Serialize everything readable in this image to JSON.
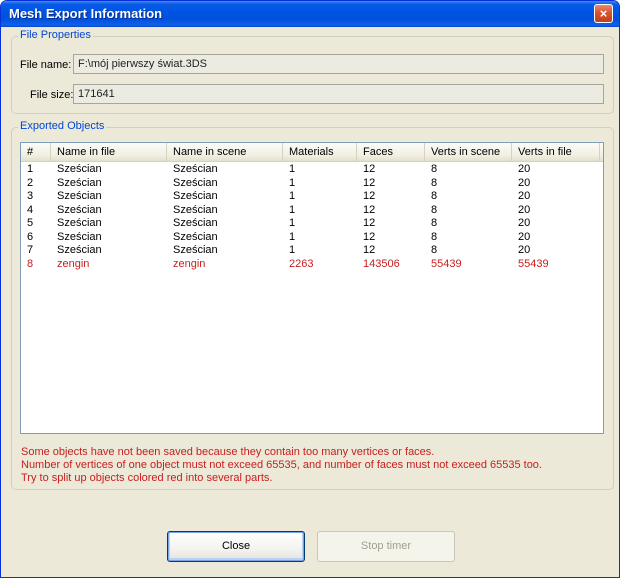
{
  "window": {
    "title": "Mesh Export Information",
    "close_glyph": "×"
  },
  "file_properties": {
    "group_title": "File Properties",
    "name_label": "File name:",
    "name_value": "F:\\mój pierwszy świat.3DS",
    "size_label": "File size:",
    "size_value": "171641"
  },
  "exported_objects": {
    "group_title": "Exported Objects",
    "columns": [
      "#",
      "Name in file",
      "Name in scene",
      "Materials",
      "Faces",
      "Verts in scene",
      "Verts in file"
    ],
    "rows": [
      {
        "num": "1",
        "name_file": "Sześcian",
        "name_scene": "Sześcian",
        "materials": "1",
        "faces": "12",
        "verts_scene": "8",
        "verts_file": "20",
        "error": false
      },
      {
        "num": "2",
        "name_file": "Sześcian",
        "name_scene": "Sześcian",
        "materials": "1",
        "faces": "12",
        "verts_scene": "8",
        "verts_file": "20",
        "error": false
      },
      {
        "num": "3",
        "name_file": "Sześcian",
        "name_scene": "Sześcian",
        "materials": "1",
        "faces": "12",
        "verts_scene": "8",
        "verts_file": "20",
        "error": false
      },
      {
        "num": "4",
        "name_file": "Sześcian",
        "name_scene": "Sześcian",
        "materials": "1",
        "faces": "12",
        "verts_scene": "8",
        "verts_file": "20",
        "error": false
      },
      {
        "num": "5",
        "name_file": "Sześcian",
        "name_scene": "Sześcian",
        "materials": "1",
        "faces": "12",
        "verts_scene": "8",
        "verts_file": "20",
        "error": false
      },
      {
        "num": "6",
        "name_file": "Sześcian",
        "name_scene": "Sześcian",
        "materials": "1",
        "faces": "12",
        "verts_scene": "8",
        "verts_file": "20",
        "error": false
      },
      {
        "num": "7",
        "name_file": "Sześcian",
        "name_scene": "Sześcian",
        "materials": "1",
        "faces": "12",
        "verts_scene": "8",
        "verts_file": "20",
        "error": false
      },
      {
        "num": "8",
        "name_file": "zengin",
        "name_scene": "zengin",
        "materials": "2263",
        "faces": "143506",
        "verts_scene": "55439",
        "verts_file": "55439",
        "error": true
      }
    ],
    "messages": [
      "Some objects have not been saved because they contain too many vertices or faces.",
      "Number of vertices of one object must not exceed 65535, and number of faces must not exceed 65535 too.",
      "Try to split up objects colored red into several parts."
    ]
  },
  "buttons": {
    "close_label": "Close",
    "stop_timer_label": "Stop timer"
  },
  "colors": {
    "error_text": "#c81e1e",
    "group_title": "#0046d5",
    "titlebar": "#0054e3"
  }
}
